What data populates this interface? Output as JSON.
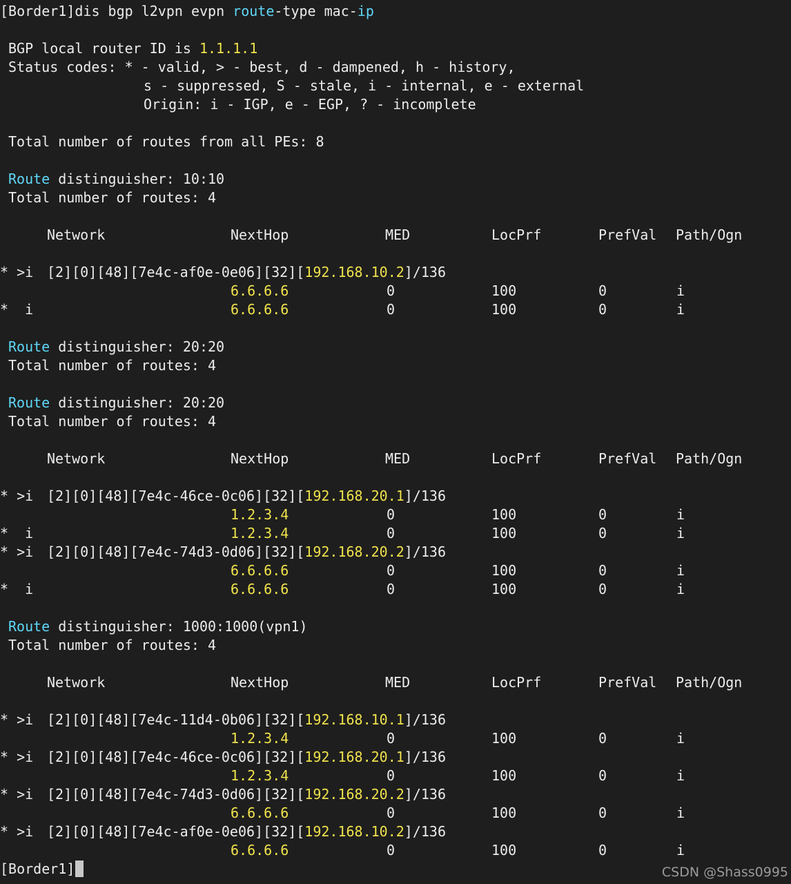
{
  "theme": {
    "background": "#1e1e1e",
    "text": "#ececec",
    "keyword": "#5fd7f7",
    "value": "#f0e24c",
    "cursor": "#c8c8c8"
  },
  "command": {
    "prompt": "[Border1]",
    "text_a": "dis bgp l2vpn evpn ",
    "kw_route": "route",
    "text_b": "-type mac-",
    "kw_ip": "ip"
  },
  "header": {
    "router_id_label": "BGP local router ID is ",
    "router_id": "1.1.1.1",
    "status_line1": "Status codes: * - valid, > - best, d - dampened, h - history,",
    "status_line2": "s - suppressed, S - stale, i - internal, e - external",
    "origin_line": "Origin: i - IGP, e - EGP, ? - incomplete",
    "total_all": "Total number of routes from all PEs: 8"
  },
  "columns": {
    "network": "Network",
    "nexthop": "NextHop",
    "med": "MED",
    "locprf": "LocPrf",
    "prefval": "PrefVal",
    "path": "Path/Ogn"
  },
  "sections": [
    {
      "rd_word": "Route",
      "rd_label": " distinguisher: ",
      "rd": "10:10",
      "total": "Total number of routes: 4",
      "routes": [
        {
          "status": "* >i",
          "prefix": "[2][0][48][7e4c-af0e-0e06][32][",
          "ip": "192.168.10.2",
          "suffix": "]/136",
          "paths": [
            {
              "status": "",
              "nexthop": "6.6.6.6",
              "med": "0",
              "locprf": "100",
              "prefval": "0",
              "path": "i"
            },
            {
              "status": "*  i",
              "nexthop": "6.6.6.6",
              "med": "0",
              "locprf": "100",
              "prefval": "0",
              "path": "i"
            }
          ]
        }
      ]
    },
    {
      "rd_word": "Route",
      "rd_label": " distinguisher: ",
      "rd": "20:20",
      "total": "Total number of routes: 4",
      "routes": []
    },
    {
      "rd_word": "Route",
      "rd_label": " distinguisher: ",
      "rd": "20:20",
      "total": "Total number of routes: 4",
      "routes": [
        {
          "status": "* >i",
          "prefix": "[2][0][48][7e4c-46ce-0c06][32][",
          "ip": "192.168.20.1",
          "suffix": "]/136",
          "paths": [
            {
              "status": "",
              "nexthop": "1.2.3.4",
              "med": "0",
              "locprf": "100",
              "prefval": "0",
              "path": "i"
            },
            {
              "status": "*  i",
              "nexthop": "1.2.3.4",
              "med": "0",
              "locprf": "100",
              "prefval": "0",
              "path": "i"
            }
          ]
        },
        {
          "status": "* >i",
          "prefix": "[2][0][48][7e4c-74d3-0d06][32][",
          "ip": "192.168.20.2",
          "suffix": "]/136",
          "paths": [
            {
              "status": "",
              "nexthop": "6.6.6.6",
              "med": "0",
              "locprf": "100",
              "prefval": "0",
              "path": "i"
            },
            {
              "status": "*  i",
              "nexthop": "6.6.6.6",
              "med": "0",
              "locprf": "100",
              "prefval": "0",
              "path": "i"
            }
          ]
        }
      ]
    },
    {
      "rd_word": "Route",
      "rd_label": " distinguisher: ",
      "rd": "1000:1000(vpn1)",
      "total": "Total number of routes: 4",
      "routes": [
        {
          "status": "* >i",
          "prefix": "[2][0][48][7e4c-11d4-0b06][32][",
          "ip": "192.168.10.1",
          "suffix": "]/136",
          "paths": [
            {
              "status": "",
              "nexthop": "1.2.3.4",
              "med": "0",
              "locprf": "100",
              "prefval": "0",
              "path": "i"
            }
          ]
        },
        {
          "status": "* >i",
          "prefix": "[2][0][48][7e4c-46ce-0c06][32][",
          "ip": "192.168.20.1",
          "suffix": "]/136",
          "paths": [
            {
              "status": "",
              "nexthop": "1.2.3.4",
              "med": "0",
              "locprf": "100",
              "prefval": "0",
              "path": "i"
            }
          ]
        },
        {
          "status": "* >i",
          "prefix": "[2][0][48][7e4c-74d3-0d06][32][",
          "ip": "192.168.20.2",
          "suffix": "]/136",
          "paths": [
            {
              "status": "",
              "nexthop": "6.6.6.6",
              "med": "0",
              "locprf": "100",
              "prefval": "0",
              "path": "i"
            }
          ]
        },
        {
          "status": "* >i",
          "prefix": "[2][0][48][7e4c-af0e-0e06][32][",
          "ip": "192.168.10.2",
          "suffix": "]/136",
          "paths": [
            {
              "status": "",
              "nexthop": "6.6.6.6",
              "med": "0",
              "locprf": "100",
              "prefval": "0",
              "path": "i"
            }
          ]
        }
      ]
    }
  ],
  "final_prompt": "[Border1]",
  "watermark": "CSDN @Shass0995"
}
